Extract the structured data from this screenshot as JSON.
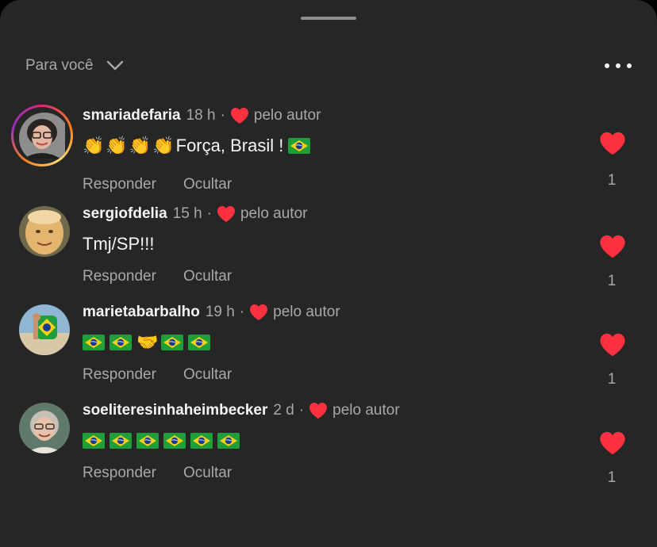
{
  "header": {
    "sort_label": "Para você",
    "chevron_icon": "chevron-down-icon",
    "more_icon": "more-options-icon"
  },
  "colors": {
    "heart": "#ff3040",
    "background": "#262626",
    "secondary_text": "#a8a8a8"
  },
  "comments": [
    {
      "username": "smariadefaria",
      "time": "18 h",
      "separator": "·",
      "liked_by_author": "pelo autor",
      "text": "Força, Brasil !",
      "emoji_prefix": [
        "👏",
        "👏",
        "👏",
        "👏"
      ],
      "emoji_suffix": [
        "flag-brazil"
      ],
      "reply_label": "Responder",
      "hide_label": "Ocultar",
      "likes": "1",
      "has_story_ring": true
    },
    {
      "username": "sergiofdelia",
      "time": "15 h",
      "separator": "·",
      "liked_by_author": "pelo autor",
      "text": "Tmj/SP!!!",
      "reply_label": "Responder",
      "hide_label": "Ocultar",
      "likes": "1",
      "has_story_ring": false
    },
    {
      "username": "marietabarbalho",
      "time": "19 h",
      "separator": "·",
      "liked_by_author": "pelo autor",
      "text": "",
      "emoji_sequence": [
        "flag-brazil",
        "flag-brazil",
        "🤝",
        "flag-brazil",
        "flag-brazil"
      ],
      "reply_label": "Responder",
      "hide_label": "Ocultar",
      "likes": "1",
      "has_story_ring": false
    },
    {
      "username": "soeliteresinhaheimbecker",
      "time": "2 d",
      "separator": "·",
      "liked_by_author": "pelo autor",
      "text": "",
      "emoji_sequence": [
        "flag-brazil",
        "flag-brazil",
        "flag-brazil",
        "flag-brazil",
        "flag-brazil",
        "flag-brazil"
      ],
      "reply_label": "Responder",
      "hide_label": "Ocultar",
      "likes": "1",
      "has_story_ring": false
    }
  ]
}
